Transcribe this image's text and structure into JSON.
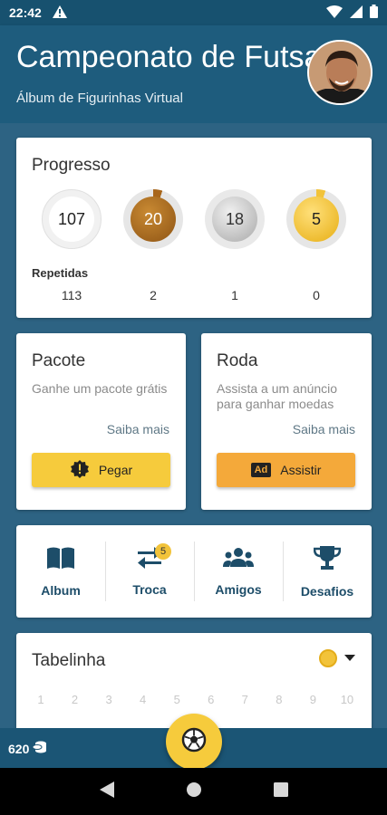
{
  "status_bar": {
    "time": "22:42"
  },
  "header": {
    "title": "Campeonato de Futsal",
    "subtitle": "Álbum de Figurinhas Virtual"
  },
  "progress": {
    "title": "Progresso",
    "counts": [
      "107",
      "20",
      "18",
      "5"
    ],
    "ring_fill": [
      0.0,
      0.05,
      0.0,
      0.05
    ],
    "repeated_label": "Repetidas",
    "repeated": [
      "113",
      "2",
      "1",
      "0"
    ]
  },
  "pacote": {
    "title": "Pacote",
    "description": "Ganhe um pacote grátis",
    "more": "Saiba mais",
    "button": "Pegar",
    "button_color": "#f6cb3c"
  },
  "roda": {
    "title": "Roda",
    "description": "Assista a um anúncio para ganhar moedas",
    "more": "Saiba mais",
    "button": "Assistir",
    "button_color": "#f4a93a",
    "button_icon_text": "Ad"
  },
  "nav": {
    "items": [
      {
        "label": "Album",
        "icon": "book-icon"
      },
      {
        "label": "Troca",
        "icon": "swap-icon",
        "badge": "5"
      },
      {
        "label": "Amigos",
        "icon": "group-icon"
      },
      {
        "label": "Desafios",
        "icon": "trophy-icon"
      }
    ]
  },
  "tabelinha": {
    "title": "Tabelinha",
    "rounds": [
      "1",
      "2",
      "3",
      "4",
      "5",
      "6",
      "7",
      "8",
      "9",
      "10"
    ]
  },
  "bottom": {
    "coins": "620"
  },
  "colors": {
    "header": "#1e5c7d",
    "background": "#2d6383",
    "gold": "#f2c33a",
    "bronze": "#a8661b",
    "silver": "#b8b8b8",
    "nav_text": "#1d4d69"
  }
}
